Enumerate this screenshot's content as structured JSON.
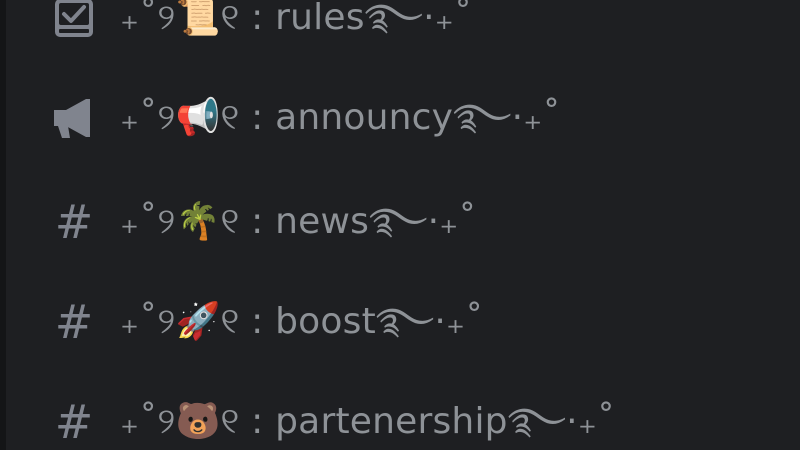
{
  "channels": [
    {
      "icon": "rules-checklist-icon",
      "name": "₊˚୨📜୧ : rules࿐·₊˚"
    },
    {
      "icon": "megaphone-icon",
      "name": "₊˚୨📢୧ : announcy࿐·₊˚"
    },
    {
      "icon": "hash-icon",
      "name": "₊˚୨🌴୧ : news࿐·₊˚"
    },
    {
      "icon": "hash-icon",
      "name": "₊˚୨🚀୧ : boost࿐·₊˚"
    },
    {
      "icon": "hash-icon",
      "name": "₊˚୨🐻୧ : partenership࿐·₊˚"
    }
  ],
  "colors": {
    "background": "#1e1f22",
    "muted_text": "#8e9297",
    "icon": "#80848e"
  }
}
